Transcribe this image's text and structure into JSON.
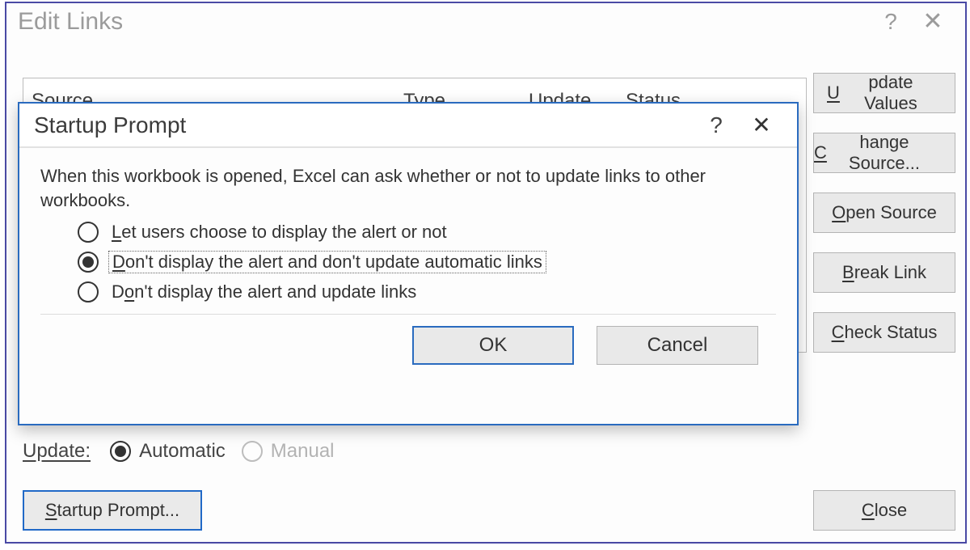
{
  "edit_links": {
    "title": "Edit Links",
    "help_char": "?",
    "close_char": "✕",
    "columns": {
      "source": "Source",
      "type": "Type",
      "update": "Update",
      "status": "Status"
    },
    "side_buttons": {
      "update_values": "pdate Values",
      "change_source": "hange Source...",
      "open_source": "pen Source",
      "break_link": "reak Link",
      "check_status": "heck Status"
    },
    "side_button_accelerators": {
      "update_values": "U",
      "change_source": "C",
      "open_source": "O",
      "break_link": "B",
      "check_status": "C"
    },
    "update_label": "Update:",
    "update_options": {
      "automatic": "utomatic",
      "automatic_accel": "A",
      "automatic_selected": true,
      "manual": "Manual",
      "manual_enabled": false
    },
    "startup_prompt_btn": "tartup Prompt...",
    "startup_prompt_accel": "S",
    "close_btn": "lose",
    "close_accel": "C"
  },
  "startup_prompt": {
    "title": "Startup Prompt",
    "help_char": "?",
    "close_char": "✕",
    "description": "When this workbook is opened, Excel can ask whether or not to update links to other workbooks.",
    "options": [
      {
        "accel": "L",
        "rest": "et users choose to display the alert or not",
        "selected": false
      },
      {
        "accel": "D",
        "rest": "on't display the alert and don't update automatic links",
        "selected": true
      },
      {
        "accel": "o",
        "prefix": "D",
        "rest": "n't display the alert and update links",
        "selected": false
      }
    ],
    "ok_label": "OK",
    "cancel_label": "Cancel"
  }
}
